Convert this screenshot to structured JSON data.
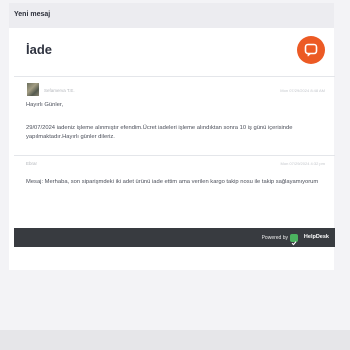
{
  "header": {
    "title": "Yeni mesaj"
  },
  "ticket": {
    "subject": "İade"
  },
  "messages": [
    {
      "sender": "Sefamerva T.E.",
      "time": "Mon 07/29/2024 8:48 AM",
      "greeting": "Hayırlı Günler,",
      "body": "29/07/2024 iadeniz işleme alınmıştır efendim.Ücret iadeleri işleme alındıktan sonra 10 iş günü içerisinde yapılmaktadır.Hayırlı günler dileriz."
    },
    {
      "sender": "Ebrar",
      "time": "Mon 07/29/2024 4:32 pm",
      "body": "Mesaj: Merhaba, son siparişmdeki iki adet ürünü iade ettim ama verilen kargo takip nosu ile takip sağlayamıyorum"
    }
  ],
  "footer": {
    "powered_by": "Powered by",
    "brand": "HelpDesk"
  },
  "colors": {
    "accent": "#ec5a24",
    "footer_bg": "#383b40",
    "brand_green": "#4bb35f"
  },
  "icons": {
    "chat": "chat-bubble-icon",
    "brand": "helpdesk-logo-icon"
  }
}
